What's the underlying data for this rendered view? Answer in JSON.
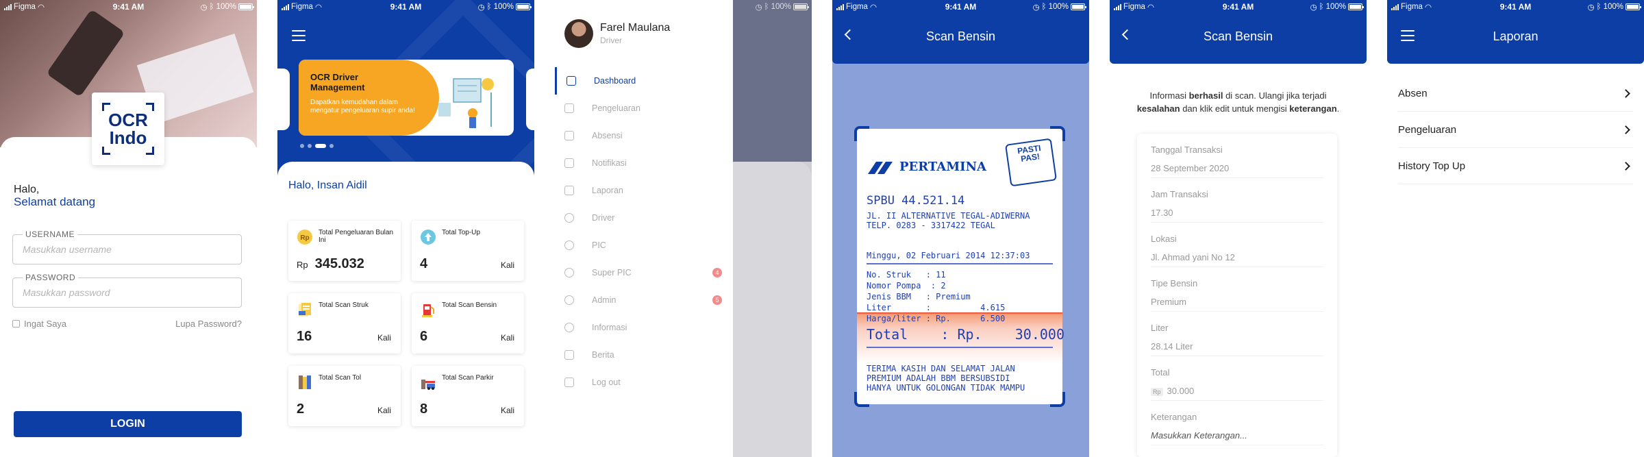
{
  "status_bar": {
    "carrier": "Figma",
    "time": "9:41 AM",
    "battery": "100%"
  },
  "login": {
    "logo_line1": "OCR",
    "logo_line2": "Indo",
    "hello": "Halo,",
    "welcome": "Selamat datang",
    "username_label": "USERNAME",
    "username_placeholder": "Masukkan username",
    "password_label": "PASSWORD",
    "password_placeholder": "Masukkan password",
    "remember": "Ingat Saya",
    "forgot": "Lupa Password?",
    "login_button": "LOGIN",
    "brand_color": "#0d3ea6"
  },
  "dashboard": {
    "banner_title": "OCR Driver Management",
    "banner_text": "Dapatkan kemudahan dalam mengatur pengeluaran supir anda!",
    "banner_color": "#f6a623",
    "greeting": "Halo, Insan Aidil",
    "stats": [
      {
        "label": "Total Pengeluaran Bulan Ini",
        "prefix": "Rp",
        "value": "345.032",
        "unit": "",
        "icon": "rupiah-coin-icon"
      },
      {
        "label": "Total Top-Up",
        "prefix": "",
        "value": "4",
        "unit": "Kali",
        "icon": "topup-arrow-icon"
      },
      {
        "label": "Total Scan Struk",
        "prefix": "",
        "value": "16",
        "unit": "Kali",
        "icon": "receipt-scan-icon"
      },
      {
        "label": "Total Scan Bensin",
        "prefix": "",
        "value": "6",
        "unit": "Kali",
        "icon": "fuel-pump-icon"
      },
      {
        "label": "Total Scan Tol",
        "prefix": "",
        "value": "2",
        "unit": "Kali",
        "icon": "toll-gate-icon"
      },
      {
        "label": "Total Scan Parkir",
        "prefix": "",
        "value": "8",
        "unit": "Kali",
        "icon": "parking-barrier-icon"
      }
    ]
  },
  "drawer": {
    "name": "Farel Maulana",
    "role": "Driver",
    "items": [
      {
        "label": "Dashboard",
        "active": true,
        "badge": ""
      },
      {
        "label": "Pengeluaran",
        "active": false,
        "badge": ""
      },
      {
        "label": "Absensi",
        "active": false,
        "badge": ""
      },
      {
        "label": "Notifikasi",
        "active": false,
        "badge": ""
      },
      {
        "label": "Laporan",
        "active": false,
        "badge": ""
      },
      {
        "label": "Driver",
        "active": false,
        "badge": ""
      },
      {
        "label": "PIC",
        "active": false,
        "badge": ""
      },
      {
        "label": "Super PIC",
        "active": false,
        "badge": "4"
      },
      {
        "label": "Admin",
        "active": false,
        "badge": "5"
      },
      {
        "label": "Informasi",
        "active": false,
        "badge": ""
      },
      {
        "label": "Berita",
        "active": false,
        "badge": ""
      },
      {
        "label": "Log out",
        "active": false,
        "badge": ""
      }
    ]
  },
  "scan": {
    "title": "Scan Bensin",
    "receipt": {
      "brand": "PERTAMINA",
      "badge": "PASTI PAS!",
      "spbu": "SPBU 44.521.14",
      "address": "JL. II ALTERNATIVE TEGAL-ADIWERNA",
      "phone": "TELP. 0283 - 3317422 TEGAL",
      "datetime": "Minggu, 02 Februari 2014 12:37:03",
      "lines": [
        "No. Struk   : 11",
        "Nomor Pompa  : 2",
        "Jenis BBM   : Premium",
        "Liter       :          4.615",
        "Harga/liter : Rp.      6.500"
      ],
      "total": "Total    : Rp.    30.000",
      "footer1": "TERIMA KASIH DAN SELAMAT JALAN",
      "footer2": "PREMIUM ADALAH BBM BERSUBSIDI",
      "footer3": "HANYA UNTUK GOLONGAN TIDAK MAMPU"
    }
  },
  "result": {
    "title": "Scan Bensin",
    "info_1": "Informasi ",
    "info_b1": "berhasil",
    "info_2": " di scan. Ulangi jika terjadi",
    "info_b2": "kesalahan",
    "info_3": " dan klik edit untuk mengisi ",
    "info_b3": "keterangan",
    "info_4": ".",
    "fields": [
      {
        "key": "Tanggal Transaksi",
        "value": "28 September 2020"
      },
      {
        "key": "Jam Transaksi",
        "value": "17.30"
      },
      {
        "key": "Lokasi",
        "value": "Jl. Ahmad yani No 12"
      },
      {
        "key": "Tipe Bensin",
        "value": "Premium"
      },
      {
        "key": "Liter",
        "value": "28.14  Liter"
      },
      {
        "key": "Total",
        "value": "30.000",
        "prefix": "Rp"
      },
      {
        "key": "Keterangan",
        "value": "Masukkan Keterangan..."
      }
    ]
  },
  "laporan": {
    "title": "Laporan",
    "items": [
      "Absen",
      "Pengeluaran",
      "History Top Up"
    ]
  }
}
